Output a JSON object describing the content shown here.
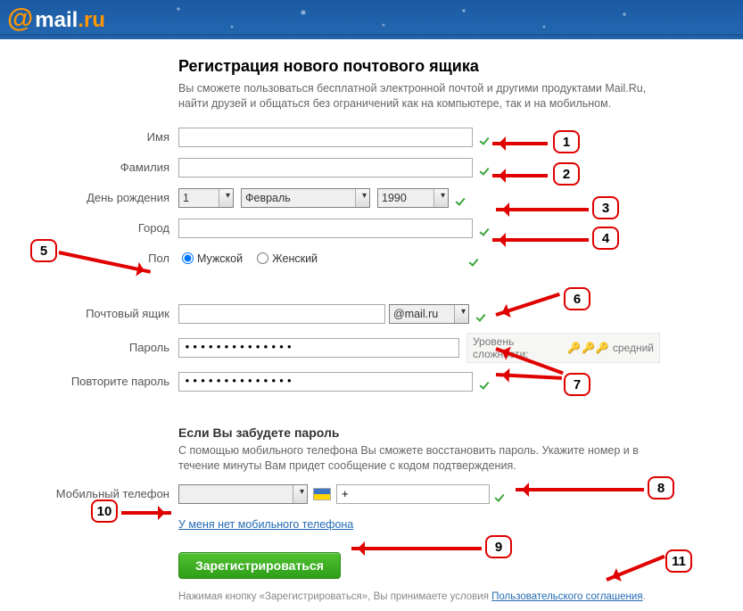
{
  "logo": {
    "at": "@",
    "name": "mail",
    "tld": ".ru"
  },
  "page": {
    "title": "Регистрация нового почтового ящика",
    "intro": "Вы сможете пользоваться бесплатной электронной почтой и другими продуктами Mail.Ru, найти друзей и общаться без ограничений как на компьютере, так и на мобильном."
  },
  "labels": {
    "firstname": "Имя",
    "lastname": "Фамилия",
    "birthday": "День рождения",
    "city": "Город",
    "gender": "Пол",
    "mailbox": "Почтовый ящик",
    "password": "Пароль",
    "password2": "Повторите пароль",
    "mobile": "Мобильный телефон"
  },
  "values": {
    "firstname": "",
    "lastname": "",
    "day": "1",
    "month": "Февраль",
    "year": "1990",
    "city": "",
    "gender_male": "Мужской",
    "gender_female": "Женский",
    "mailbox": "",
    "domain": "@mail.ru",
    "password": "••••••••••••••",
    "password2": "••••••••••••••",
    "country": "",
    "phone": "+"
  },
  "password_strength": {
    "label": "Уровень сложности:",
    "value": "средний",
    "level": 2,
    "max": 3
  },
  "recovery": {
    "title": "Если Вы забудете пароль",
    "text": "С помощью мобильного телефона Вы сможете восстановить пароль. Укажите номер и в течение минуты Вам придет сообщение с кодом подтверждения.",
    "no_phone_link": "У меня нет мобильного телефона"
  },
  "actions": {
    "submit": "Зарегистрироваться"
  },
  "footnote": {
    "prefix": "Нажимая кнопку «Зарегистрироваться», Вы принимаете условия ",
    "link": "Пользовательского соглашения",
    "suffix": "."
  },
  "annotations": {
    "1": "1",
    "2": "2",
    "3": "3",
    "4": "4",
    "5": "5",
    "6": "6",
    "7": "7",
    "8": "8",
    "9": "9",
    "10": "10",
    "11": "11"
  }
}
